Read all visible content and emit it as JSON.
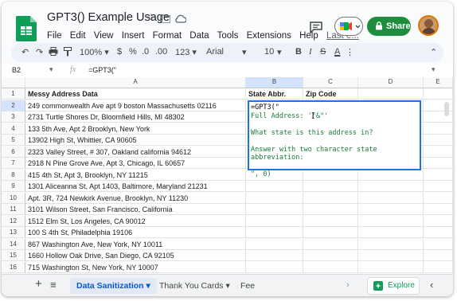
{
  "doc": {
    "title": "GPT3() Example Usage"
  },
  "menu": [
    "File",
    "Edit",
    "View",
    "Insert",
    "Format",
    "Data",
    "Tools",
    "Extensions",
    "Help"
  ],
  "last_edit": "Last e...",
  "share_label": "Share",
  "toolbar": {
    "zoom": "100%",
    "currency": "$",
    "percent": "%",
    "dec_less": ".0",
    "dec_more": ".00",
    "num_format": "123",
    "font": "Arial",
    "font_size": "10"
  },
  "formula_bar": {
    "cell_ref": "B2",
    "fx": "fx",
    "formula": "=GPT3(\""
  },
  "columns": [
    "A",
    "B",
    "C",
    "D",
    "E"
  ],
  "row_numbers": [
    "1",
    "2",
    "3",
    "4",
    "5",
    "6",
    "7",
    "8",
    "9",
    "10",
    "11",
    "12",
    "13",
    "14",
    "15",
    "16"
  ],
  "headers": {
    "a": "Messy Address Data",
    "b": "State Abbr.",
    "c": "Zip Code"
  },
  "addresses": [
    "249 commonwealth Ave apt 9 boston Massachusetts 02116",
    "2731 Turtle Shores Dr, Bloomfield Hills, MI 48302",
    "133 5th Ave, Apt 2 Brooklyn, New York",
    "13902 High St, Whittier, CA 90605",
    "2323 Valley Street, # 307, Oakland california 94612",
    "2918 N Pine Grove Ave, Apt 3, Chicago, IL 60657",
    "415 4th St, Apt 3, Brooklyn, NY 11215",
    "1301 Aliceanna St, Apt 1403, Baltimore, Maryland 21231",
    "Apt. 3R, 724 Newkirk Avenue, Brooklyn, NY 11230",
    "3101 Wilson Street, San Francisco, California",
    "1512 Elm St, Los Angeles, CA 90012",
    "100 S 4th St, Philadelphia 19106",
    "867 Washington Ave, New York, NY 10011",
    "1660 Hollow Oak Drive, San Diego, CA 92105",
    "715 Washington St, New York, NY 10007"
  ],
  "editor": {
    "line1": "=GPT3(\"",
    "line2": "Full Address: '\"&\"'",
    "line3": "What state is this address in?",
    "line4": "Answer with two character state abbreviation:",
    "line5": "\", 0)"
  },
  "sheets": {
    "tab1": "Data Sanitization",
    "tab2": "Thank You Cards",
    "tab3": "Fee"
  },
  "explore_label": "Explore",
  "colors": {
    "accent": "#1a73e8",
    "share": "#1e8e3e",
    "formula_text": "#188038"
  }
}
